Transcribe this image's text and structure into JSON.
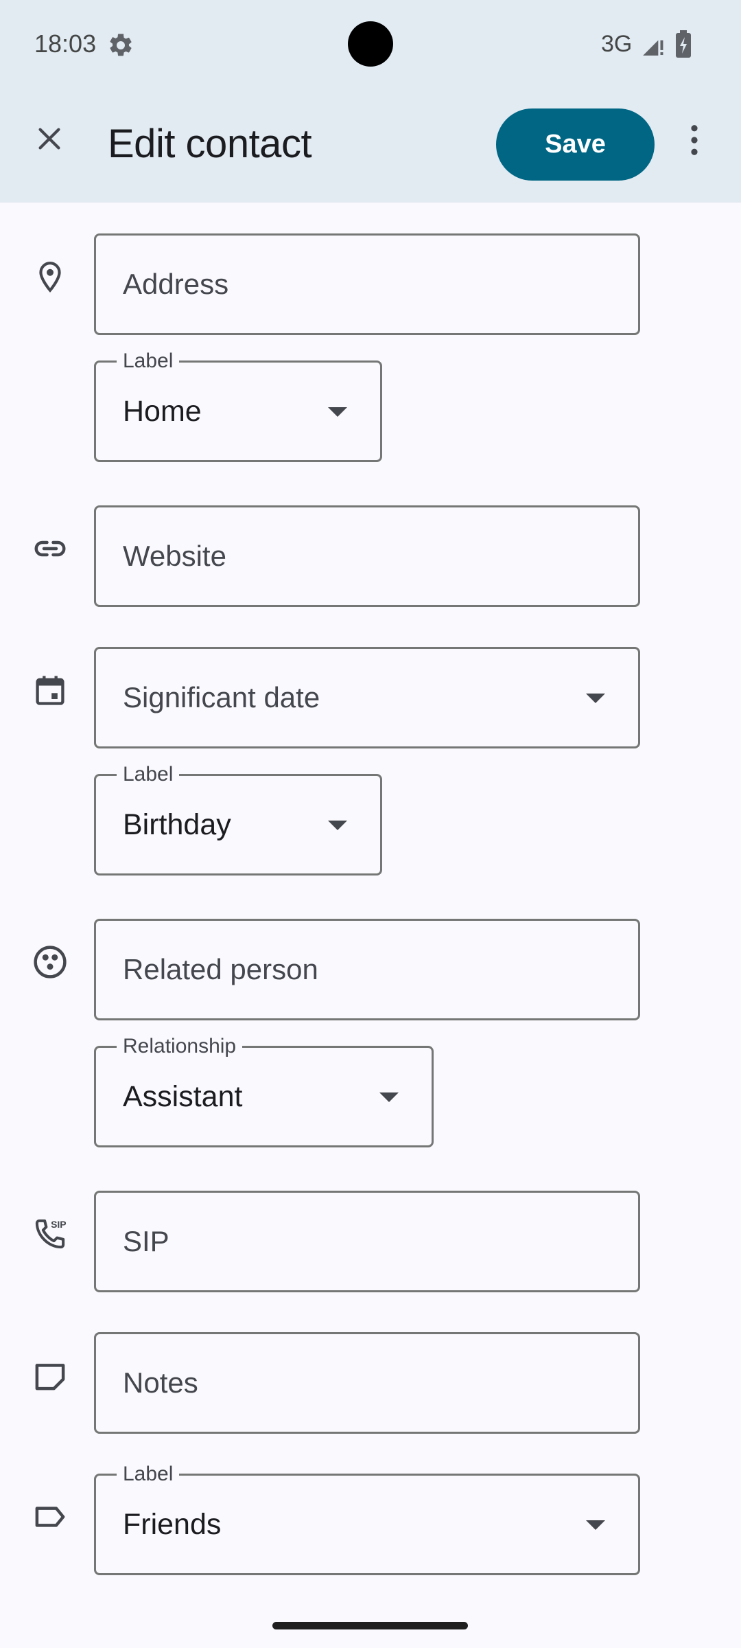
{
  "status_bar": {
    "time": "18:03",
    "network": "3G",
    "settings_icon": "gear-icon",
    "signal_icon": "signal-icon",
    "battery_icon": "battery-charging-icon"
  },
  "app_bar": {
    "close_icon": "close-icon",
    "title": "Edit contact",
    "save_label": "Save",
    "more_icon": "more-vert-icon",
    "accent_color": "#006684"
  },
  "form": {
    "address": {
      "icon": "location-pin-icon",
      "placeholder": "Address",
      "label_caption": "Label",
      "label_value": "Home"
    },
    "website": {
      "icon": "link-icon",
      "placeholder": "Website"
    },
    "significant_date": {
      "icon": "calendar-icon",
      "placeholder": "Significant date",
      "label_caption": "Label",
      "label_value": "Birthday"
    },
    "related_person": {
      "icon": "people-circle-icon",
      "placeholder": "Related person",
      "relationship_caption": "Relationship",
      "relationship_value": "Assistant"
    },
    "sip": {
      "icon": "sip-phone-icon",
      "placeholder": "SIP",
      "icon_text": "SIP"
    },
    "notes": {
      "icon": "note-icon",
      "placeholder": "Notes"
    },
    "group_label": {
      "icon": "label-tag-icon",
      "caption": "Label",
      "value": "Friends"
    }
  }
}
